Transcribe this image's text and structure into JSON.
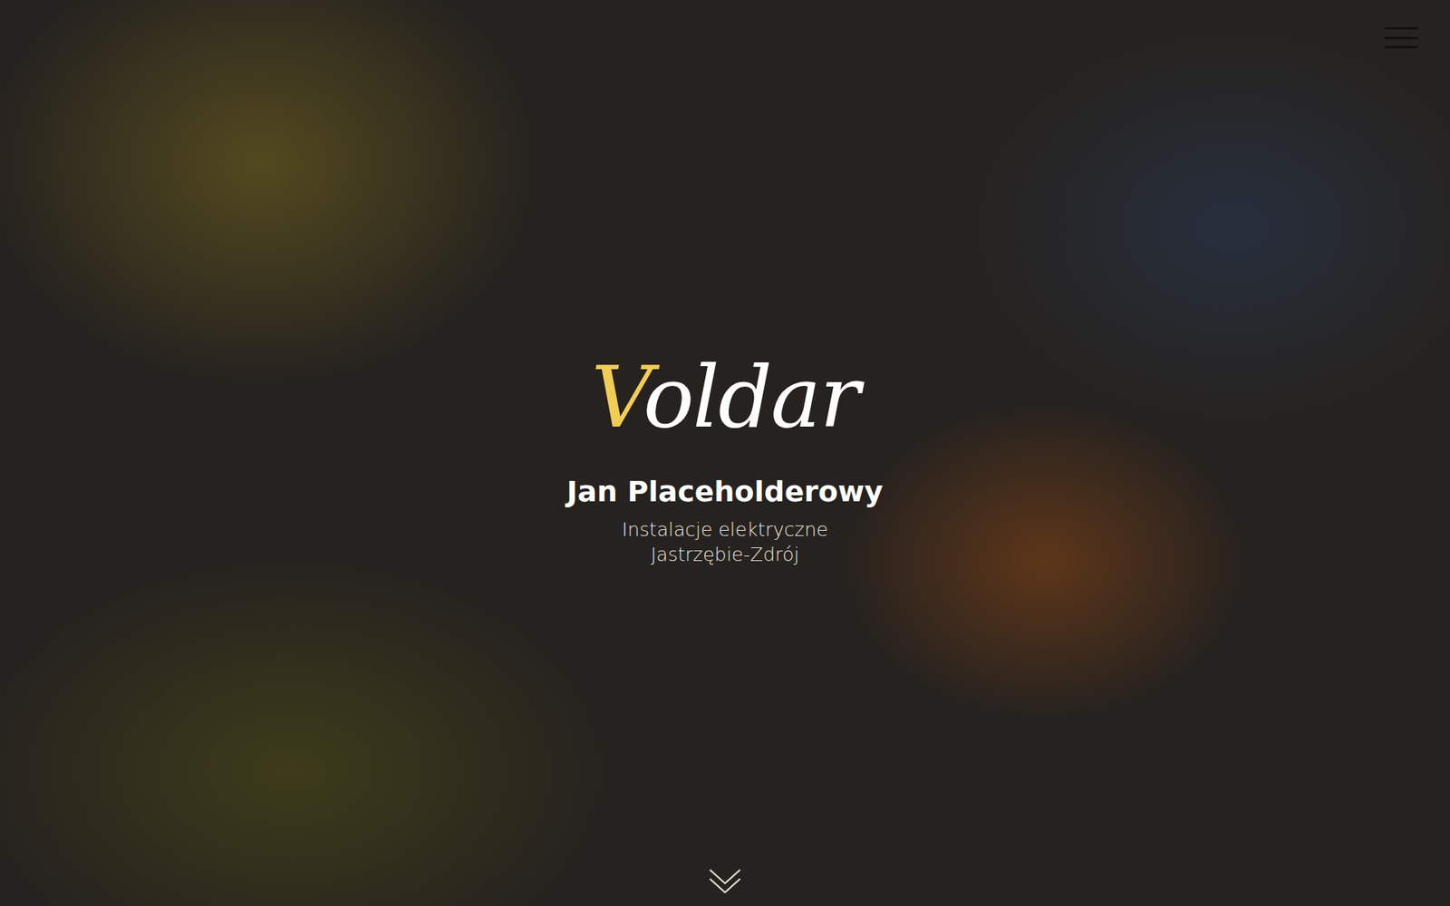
{
  "logo": {
    "parts": [
      {
        "text": "V",
        "color": "#f2cd55"
      },
      {
        "text": "oldar",
        "color": "#ffffff"
      }
    ]
  },
  "owner": "Jan Placeholderowy",
  "tagline": [
    "Instalacje elektryczne",
    "Jastrzębie-Zdrój"
  ]
}
